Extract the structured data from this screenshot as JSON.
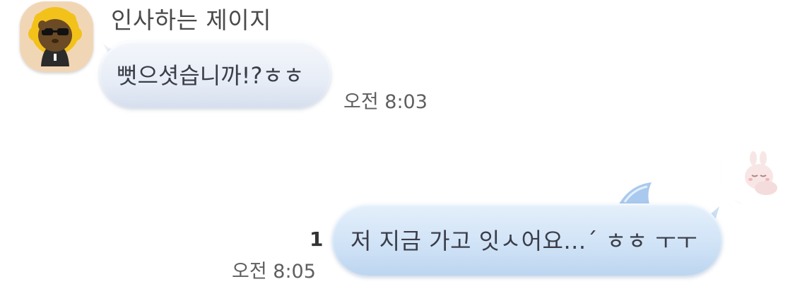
{
  "incoming": {
    "sender_name": "인사하는 제이지",
    "avatar_icon": "jay-g-character-avatar",
    "message": "뻣으셧습니까!?ㅎㅎ",
    "time": "오전 8:03"
  },
  "outgoing": {
    "message": "저 지금 가고 잇ㅅ어요...ˊ ㅎㅎ ㅜㅜ",
    "unread_count": "1",
    "time": "오전 8:05",
    "sticker_icon": "bunny-sleeping-on-moon-sticker"
  },
  "colors": {
    "incoming_bubble": "#e6ecf6",
    "outgoing_bubble": "#cfe2f6",
    "avatar_bg": "#f1d6b6"
  }
}
